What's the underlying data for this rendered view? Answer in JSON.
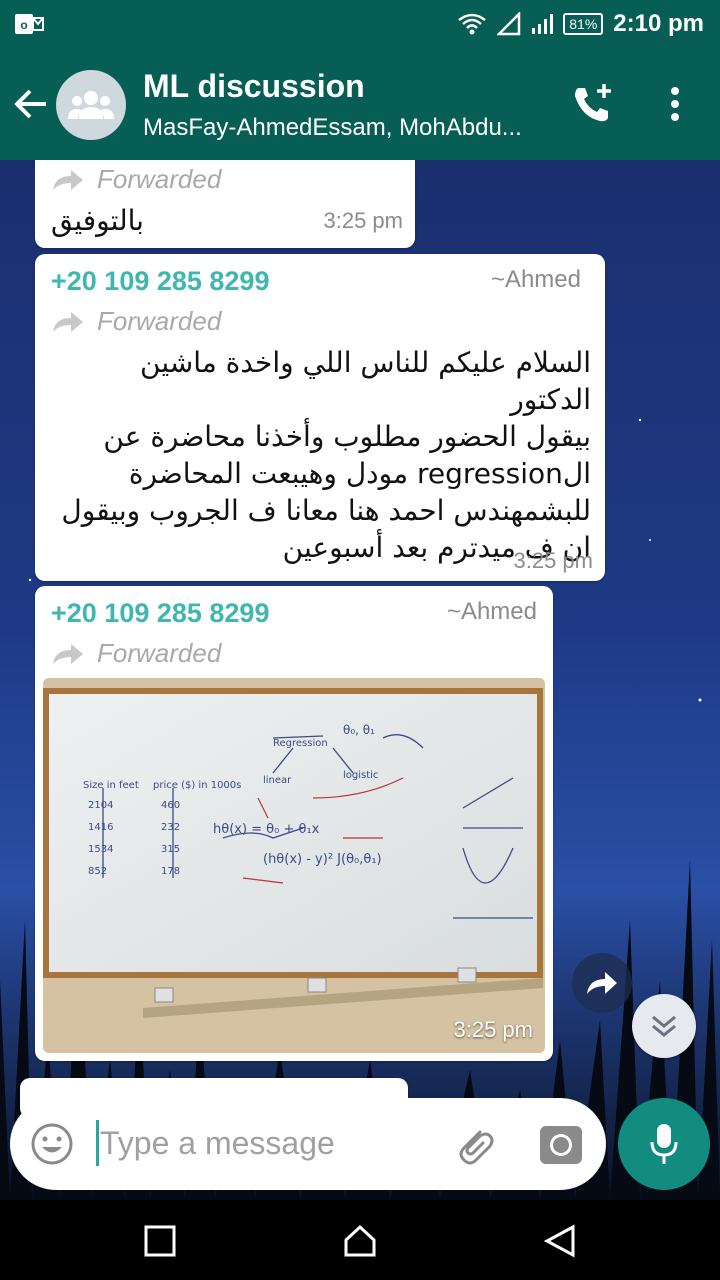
{
  "status_bar": {
    "battery": "81%",
    "time": "2:10 pm"
  },
  "header": {
    "title": "ML discussion",
    "subtitle": "MasFay-AhmedEssam, MohAbdu..."
  },
  "messages": [
    {
      "forwarded_label": "Forwarded",
      "text": "بالتوفيق",
      "time": "3:25 pm"
    },
    {
      "sender_phone": "+20 109 285 8299",
      "sender_name": "~Ahmed",
      "forwarded_label": "Forwarded",
      "lines": [
        "السلام عليكم للناس اللي واخدة ماشين الدكتور",
        "بيقول الحضور مطلوب وأخذنا محاضرة عن",
        "الregression مودل وهيبعت المحاضرة",
        "للبشمهندس احمد هنا معانا ف الجروب وبيقول",
        "ان ف ميدترم بعد أسبوعين"
      ],
      "time": "3:25 pm"
    },
    {
      "sender_phone": "+20 109 285 8299",
      "sender_name": "~Ahmed",
      "forwarded_label": "Forwarded",
      "image": "whiteboard-photo",
      "time": "3:25 pm"
    }
  ],
  "composer": {
    "placeholder": "Type a message"
  },
  "colors": {
    "header": "#075e54",
    "accent": "#128c7e",
    "sender": "#3fb6b0"
  }
}
